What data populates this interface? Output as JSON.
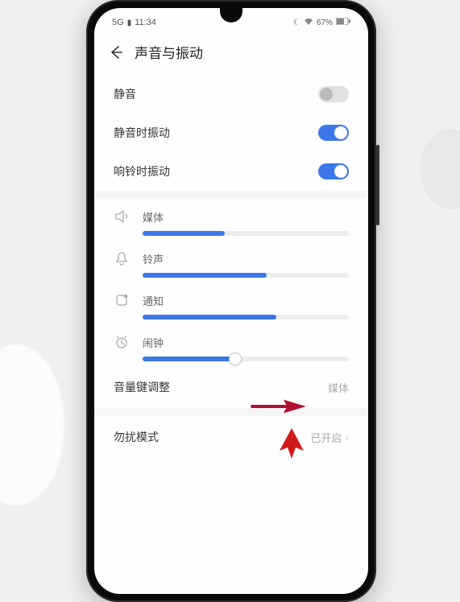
{
  "statusbar": {
    "network": "5G",
    "time": "11:34",
    "moon": "☾",
    "wifi": "�honoured",
    "battery_pct": "67%"
  },
  "header": {
    "title": "声音与振动"
  },
  "toggles": {
    "mute": {
      "label": "静音",
      "on": false
    },
    "vibrate_mute": {
      "label": "静音时振动",
      "on": true
    },
    "vibrate_ring": {
      "label": "响铃时振动",
      "on": true
    }
  },
  "sliders": {
    "media": {
      "label": "媒体",
      "value": 40
    },
    "ring": {
      "label": "铃声",
      "value": 60
    },
    "notify": {
      "label": "通知",
      "value": 65
    },
    "alarm": {
      "label": "闹钟",
      "value": 45
    }
  },
  "volkey": {
    "label": "音量键调整",
    "value": "媒体"
  },
  "dnd": {
    "label": "勿扰模式",
    "value": "已开启"
  }
}
